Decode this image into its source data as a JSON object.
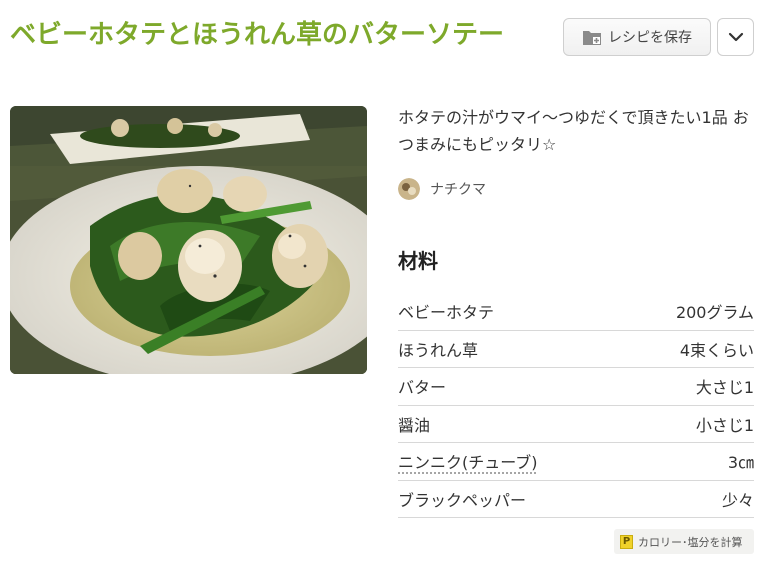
{
  "recipe": {
    "title": "ベビーホタテとほうれん草のバターソテー",
    "description": "ホタテの汁がウマイ～つゆだくで頂きたい1品 おつまみにもピッタリ☆",
    "author": "ナチクマ"
  },
  "toolbar": {
    "save_label": "レシピを保存"
  },
  "ingredients": {
    "heading": "材料",
    "items": [
      {
        "name": "ベビーホタテ",
        "amount": "200グラム"
      },
      {
        "name": "ほうれん草",
        "amount": "4束くらい"
      },
      {
        "name": "バター",
        "amount": "大さじ1"
      },
      {
        "name": "醤油",
        "amount": "小さじ1"
      },
      {
        "name": "ニンニク(チューブ)",
        "amount": "3㎝"
      },
      {
        "name": "ブラックペッパー",
        "amount": "少々"
      }
    ]
  },
  "calorie": {
    "icon_letter": "P",
    "label": "カロリー･塩分を計算"
  },
  "colors": {
    "title": "#7ea92b"
  }
}
